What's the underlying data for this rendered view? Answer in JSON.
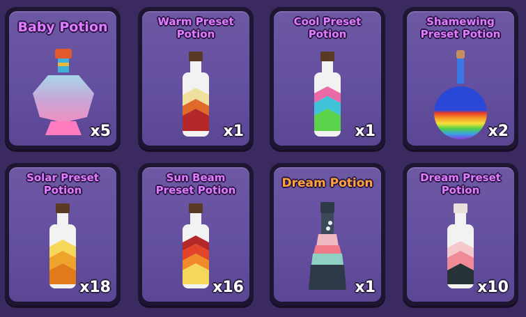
{
  "inventory": {
    "items": [
      {
        "name": "Baby Potion",
        "count": "x5"
      },
      {
        "name": "Warm Preset\nPotion",
        "count": "x1"
      },
      {
        "name": "Cool Preset\nPotion",
        "count": "x1"
      },
      {
        "name": "Shamewing\nPreset Potion",
        "count": "x2"
      },
      {
        "name": "Solar Preset\nPotion",
        "count": "x18"
      },
      {
        "name": "Sun Beam\nPreset Potion",
        "count": "x16"
      },
      {
        "name": "Dream Potion",
        "count": "x1"
      },
      {
        "name": "Dream Preset\nPotion",
        "count": "x10"
      }
    ]
  },
  "colors": {
    "background": "#3a2a60",
    "slot_fill": "#6450a0",
    "name_purple": "#e27cff",
    "name_orange": "#ffa33a"
  }
}
